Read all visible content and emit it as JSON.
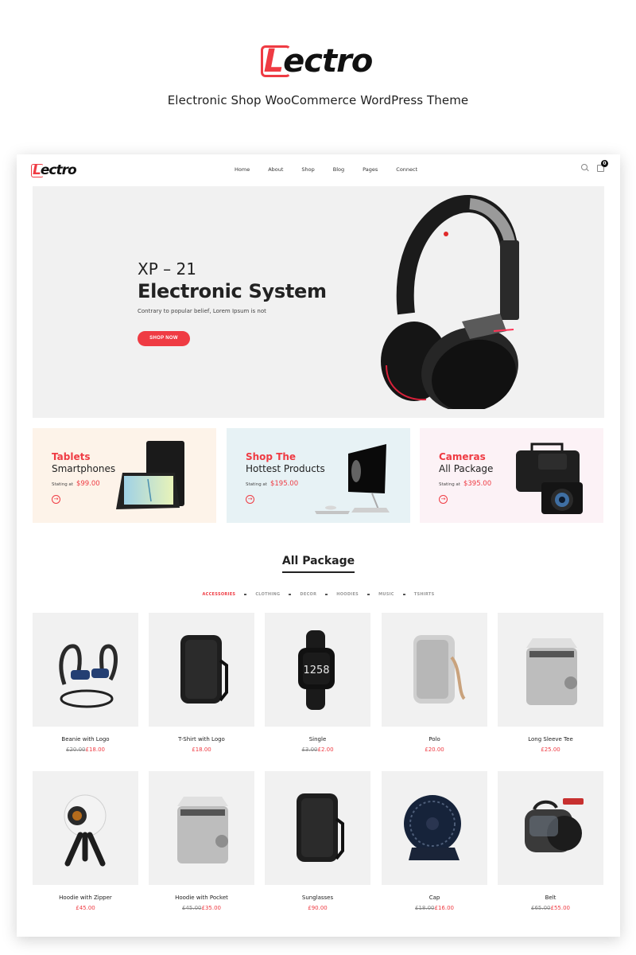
{
  "promo": {
    "logo_first_letter": "L",
    "logo_rest": "ectro",
    "subtitle": "Electronic Shop WooCommerce WordPress Theme"
  },
  "nav": {
    "logo_first_letter": "L",
    "logo_rest": "ectro",
    "menu": [
      "Home",
      "About",
      "Shop",
      "Blog",
      "Pages",
      "Connect"
    ],
    "cart_count": "0",
    "icons": [
      "search-icon",
      "cart-icon"
    ]
  },
  "hero": {
    "subtitle": "XP – 21",
    "title": "Electronic System",
    "description": "Contrary to popular belief, Lorem Ipsum is not",
    "button": "SHOP NOW",
    "image": "headphones"
  },
  "banners": [
    {
      "title_accent": "Tablets",
      "title": "Smartphones",
      "from_label": "Stating at",
      "price": "$99.00",
      "image": "tablet",
      "background": "#fdf3e9"
    },
    {
      "title_accent": "Shop The",
      "title": "Hottest Products",
      "from_label": "Stating at",
      "price": "$195.00",
      "image": "desktop-computer",
      "background": "#e7f2f5"
    },
    {
      "title_accent": "Cameras",
      "title": "All Package",
      "from_label": "Stating at",
      "price": "$395.00",
      "image": "camera-bag",
      "background": "#fcf2f6"
    }
  ],
  "section": {
    "title": "All Package",
    "filters": [
      "ACCESSORIES",
      "CLOTHING",
      "DECOR",
      "HOODIES",
      "MUSIC",
      "TSHIRTS"
    ],
    "active_filter": "ACCESSORIES"
  },
  "products": [
    {
      "name": "Beanie with Logo",
      "old_price": "£20.00",
      "price": "£18.00",
      "image": "earbuds"
    },
    {
      "name": "T-Shirt with Logo",
      "old_price": "",
      "price": "£18.00",
      "image": "speaker-black"
    },
    {
      "name": "Single",
      "old_price": "£3.00",
      "price": "£2.00",
      "image": "smartwatch"
    },
    {
      "name": "Polo",
      "old_price": "",
      "price": "£20.00",
      "image": "speaker-silver"
    },
    {
      "name": "Long Sleeve Tee",
      "old_price": "",
      "price": "£25.00",
      "image": "ice-maker"
    },
    {
      "name": "Hoodie with Zipper",
      "old_price": "",
      "price": "£45.00",
      "image": "360-camera"
    },
    {
      "name": "Hoodie with Pocket",
      "old_price": "£45.00",
      "price": "£35.00",
      "image": "ice-maker"
    },
    {
      "name": "Sunglasses",
      "old_price": "",
      "price": "£90.00",
      "image": "speaker-black"
    },
    {
      "name": "Cap",
      "old_price": "£18.00",
      "price": "£16.00",
      "image": "desk-fan"
    },
    {
      "name": "Belt",
      "old_price": "£65.00",
      "price": "£55.00",
      "image": "carpet-cleaner"
    }
  ],
  "colors": {
    "accent": "#ef3b43",
    "text": "#222222",
    "muted": "#888888",
    "card_bg": "#f1f1f1"
  }
}
